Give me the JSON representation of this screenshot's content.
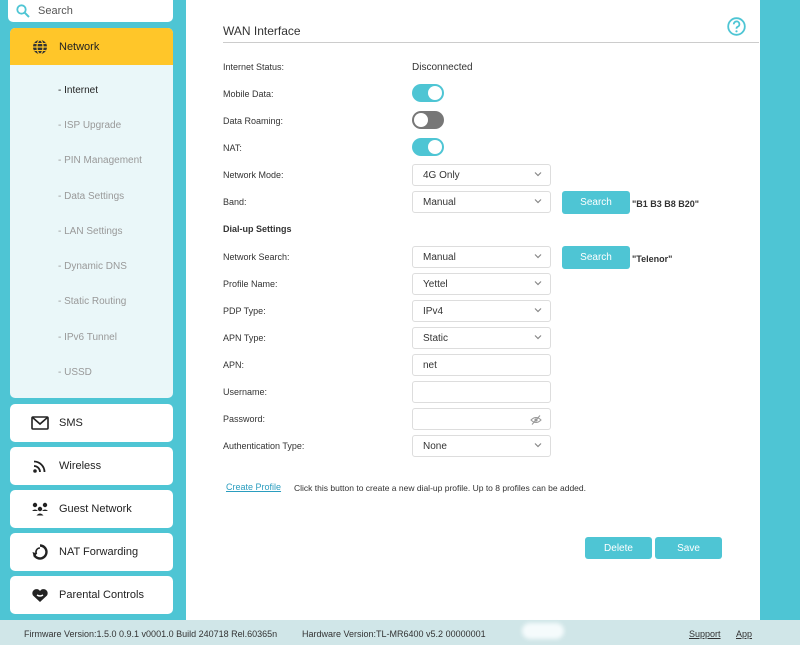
{
  "search": {
    "placeholder": "Search"
  },
  "sidebar": {
    "network": {
      "label": "Network",
      "items": [
        "- Internet",
        "- ISP Upgrade",
        "- PIN Management",
        "- Data Settings",
        "- LAN Settings",
        "- Dynamic DNS",
        "- Static Routing",
        "- IPv6 Tunnel",
        "- USSD"
      ]
    },
    "menu": [
      "SMS",
      "Wireless",
      "Guest Network",
      "NAT Forwarding",
      "Parental Controls"
    ]
  },
  "main": {
    "title": "WAN Interface",
    "internet_status_label": "Internet Status:",
    "internet_status_value": "Disconnected",
    "mobile_data_label": "Mobile Data:",
    "data_roaming_label": "Data Roaming:",
    "nat_label": "NAT:",
    "toggles": {
      "mobile_data": true,
      "data_roaming": false,
      "nat": true
    },
    "network_mode_label": "Network Mode:",
    "network_mode_value": "4G Only",
    "band_label": "Band:",
    "band_value": "Manual",
    "band_search_button": "Search",
    "band_result": "\"B1 B3 B8 B20\"",
    "dialup_heading": "Dial-up Settings",
    "network_search_label": "Network Search:",
    "network_search_value": "Manual",
    "network_search_button": "Search",
    "network_search_result": "\"Telenor\"",
    "profile_name_label": "Profile Name:",
    "profile_name_value": "Yettel",
    "pdp_type_label": "PDP Type:",
    "pdp_type_value": "IPv4",
    "apn_type_label": "APN Type:",
    "apn_type_value": "Static",
    "apn_label": "APN:",
    "apn_value": "net",
    "username_label": "Username:",
    "username_value": "",
    "password_label": "Password:",
    "password_value": "",
    "auth_type_label": "Authentication Type:",
    "auth_type_value": "None",
    "create_profile_link": "Create Profile",
    "create_profile_hint": "Click this button to create a new dial-up profile. Up to 8 profiles can be added.",
    "delete_button": "Delete",
    "save_button": "Save"
  },
  "footer": {
    "firmware": "Firmware Version:1.5.0 0.9.1 v0001.0 Build 240718 Rel.60365n",
    "hardware": "Hardware Version:TL-MR6400 v5.2 00000001",
    "support": "Support",
    "app": "App"
  },
  "colors": {
    "accent": "#4ec5d4",
    "active_menu": "#ffc629",
    "link": "#2a9dbf"
  }
}
